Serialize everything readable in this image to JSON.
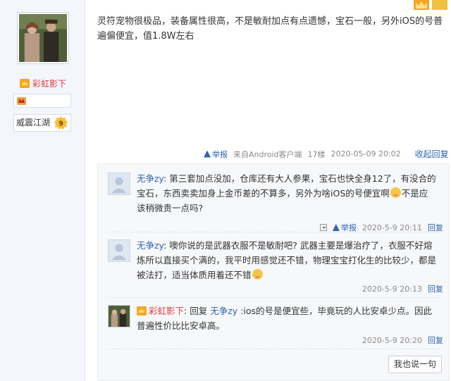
{
  "sidebar": {
    "username": "彩虹影下",
    "title": "威震江湖",
    "level": "9"
  },
  "post": {
    "content": "灵符宠物很极品，装备属性很高，不是敏耐加点有点遗憾，宝石一般，另外iOS的号普遍偏便宜，值1.8W左右",
    "meta": {
      "report_label": "举报",
      "source": "来自Android客户端",
      "floor": "17楼",
      "datetime": "2020-05-09 20:02",
      "collapse_label": "收起回复"
    }
  },
  "replies": [
    {
      "author": "无争zy",
      "text_before_emoji": ": 第三套加点没加，仓库还有大人参果，宝石也快全身12了，有没合的宝石，东西卖卖加身上金币差的不算多，另外为啥iOS的号便宜啊",
      "text_after_emoji": "不是应该稍微贵一点吗?",
      "report_label": "举报",
      "datetime": "2020-5-9 20:11",
      "reply_label": "回复"
    },
    {
      "author": "无争zy",
      "text_before_emoji": ": 噢你说的是武器衣服不是敏耐吧? 武器主要是爆治疗了，衣服不好熔炼所以直接买个满的，我平时用感觉还不错，物理宝宝打化生的比较少，都是被法打，适当体质用着还不错",
      "text_after_emoji": "",
      "datetime": "2020-5-9 20:13",
      "reply_label": "回复"
    },
    {
      "author": "彩虹影下",
      "reply_word": ": 回复",
      "target": "无争zy",
      "text": " :ios的号是便宜些，毕竟玩的人比安卓少点。因此普遍性价比比安卓高。",
      "datetime": "2020-5-9 20:20",
      "reply_label": "回复"
    }
  ],
  "say_button": "我也说一句",
  "icons": [
    "vip-crown-icon",
    "title-badge-icon",
    "level-badge-icon",
    "warning-icon",
    "dropdown-icon",
    "emoji-icon",
    "avatar"
  ]
}
